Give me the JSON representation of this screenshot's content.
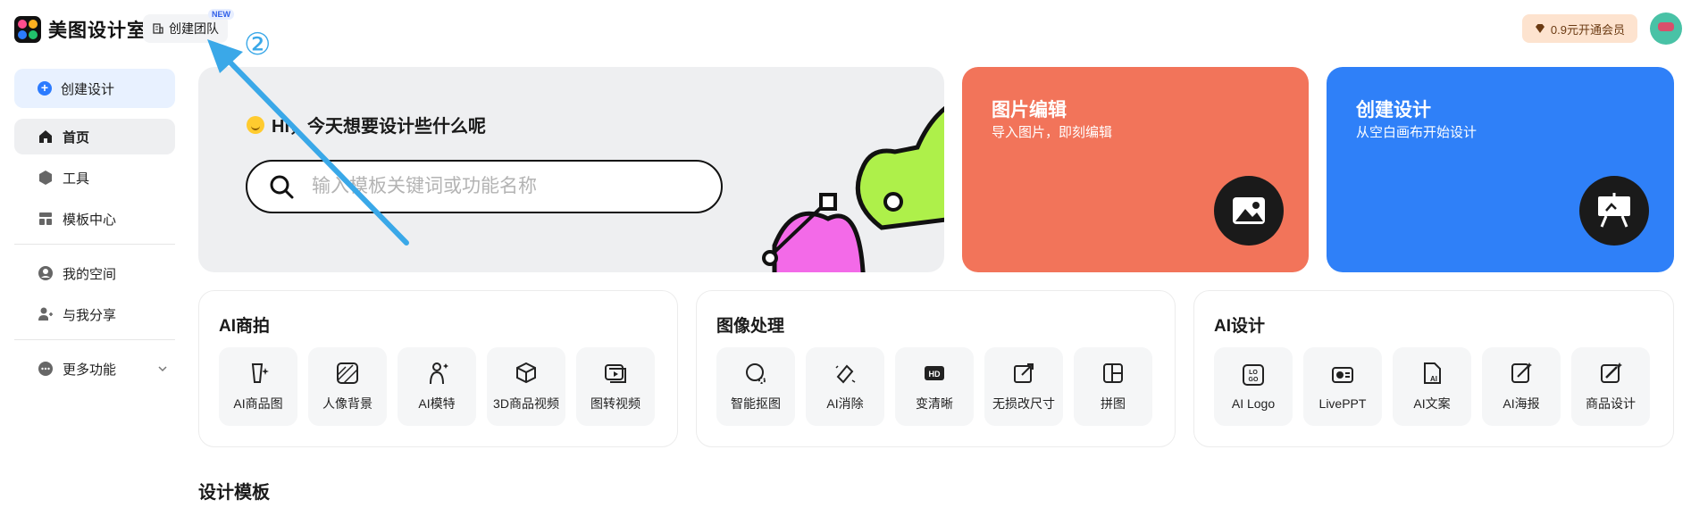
{
  "header": {
    "brand": "美图设计室",
    "team_button": "创建团队",
    "new_badge": "NEW",
    "vip_button": "0.9元开通会员"
  },
  "sidebar": {
    "create": "创建设计",
    "items": [
      {
        "label": "首页",
        "icon": "home-icon"
      },
      {
        "label": "工具",
        "icon": "box-icon"
      },
      {
        "label": "模板中心",
        "icon": "template-icon"
      },
      {
        "label": "我的空间",
        "icon": "user-icon"
      },
      {
        "label": "与我分享",
        "icon": "share-user-icon"
      },
      {
        "label": "更多功能",
        "icon": "more-icon"
      }
    ]
  },
  "hero": {
    "greeting": "Hi，今天想要设计些什么呢",
    "search_placeholder": "输入模板关键词或功能名称"
  },
  "features": [
    {
      "title": "图片编辑",
      "subtitle": "导入图片，即刻编辑",
      "color": "#f2745a"
    },
    {
      "title": "创建设计",
      "subtitle": "从空白画布开始设计",
      "color": "#2f80f8"
    }
  ],
  "groups": [
    {
      "title": "AI商拍",
      "tools": [
        "AI商品图",
        "人像背景",
        "AI模特",
        "3D商品视频",
        "图转视频"
      ]
    },
    {
      "title": "图像处理",
      "tools": [
        "智能抠图",
        "AI消除",
        "变清晰",
        "无损改尺寸",
        "拼图"
      ]
    },
    {
      "title": "AI设计",
      "tools": [
        "AI Logo",
        "LivePPT",
        "AI文案",
        "AI海报",
        "商品设计"
      ]
    }
  ],
  "section_title": "设计模板",
  "annotation": "②"
}
